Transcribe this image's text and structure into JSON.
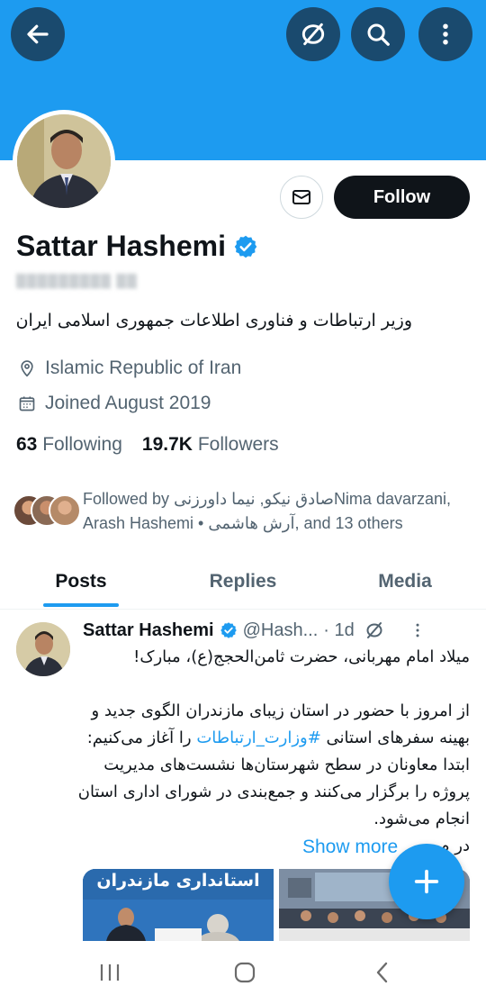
{
  "header": {
    "back_icon": "arrow-left-icon",
    "hide_icon": "eye-slash-icon",
    "search_icon": "search-icon",
    "more_icon": "more-vertical-icon",
    "banner_color": "#1d9bf0"
  },
  "profile": {
    "name": "Sattar Hashemi",
    "verified_icon": "verified-badge-icon",
    "bio": "وزیر ارتباطات و فناوری اطلاعات جمهوری اسلامی ایران",
    "location": "Islamic Republic of Iran",
    "joined": "Joined August 2019",
    "following_count": "63",
    "following_label": "Following",
    "followers_count": "19.7K",
    "followers_label": "Followers",
    "follow_button": "Follow",
    "message_icon": "envelope-icon",
    "followed_by_line1": "Followed by صادق نیکو, نیما داورزنیNima davarzani,",
    "followed_by_line2": "Arash Hashemi • آرش هاشمی, and 13 others"
  },
  "tabs": [
    {
      "label": "Posts",
      "active": true
    },
    {
      "label": "Replies",
      "active": false
    },
    {
      "label": "Media",
      "active": false
    }
  ],
  "post": {
    "author": "Sattar Hashemi",
    "handle": "@Hash...",
    "time": "· 1d",
    "line1": "میلاد امام مهربانی، حضرت ثامن‌الحجج(ع)، مبارک!",
    "para2_a": "از امروز با حضور در استان زیبای مازندران الگوی جدید و بهینه سفرهای استانی",
    "hashtag": "#وزارت_ارتباطات",
    "para2_b": "را آغاز می‌کنیم: ابتدا معاونان در سطح شهرستان‌ها نشست‌های مدیریت پروژه را برگزار می‌کنند و جمع‌بندی در شورای اداری استان انجام می‌شود.",
    "line_cut": "در م",
    "show_more": "Show more",
    "media1_caption": "استانداری مازندران"
  },
  "fab": {
    "icon": "plus-icon"
  },
  "android_nav": {
    "recents_icon": "recents-icon",
    "home_icon": "home-icon",
    "back_icon": "nav-back-icon"
  }
}
